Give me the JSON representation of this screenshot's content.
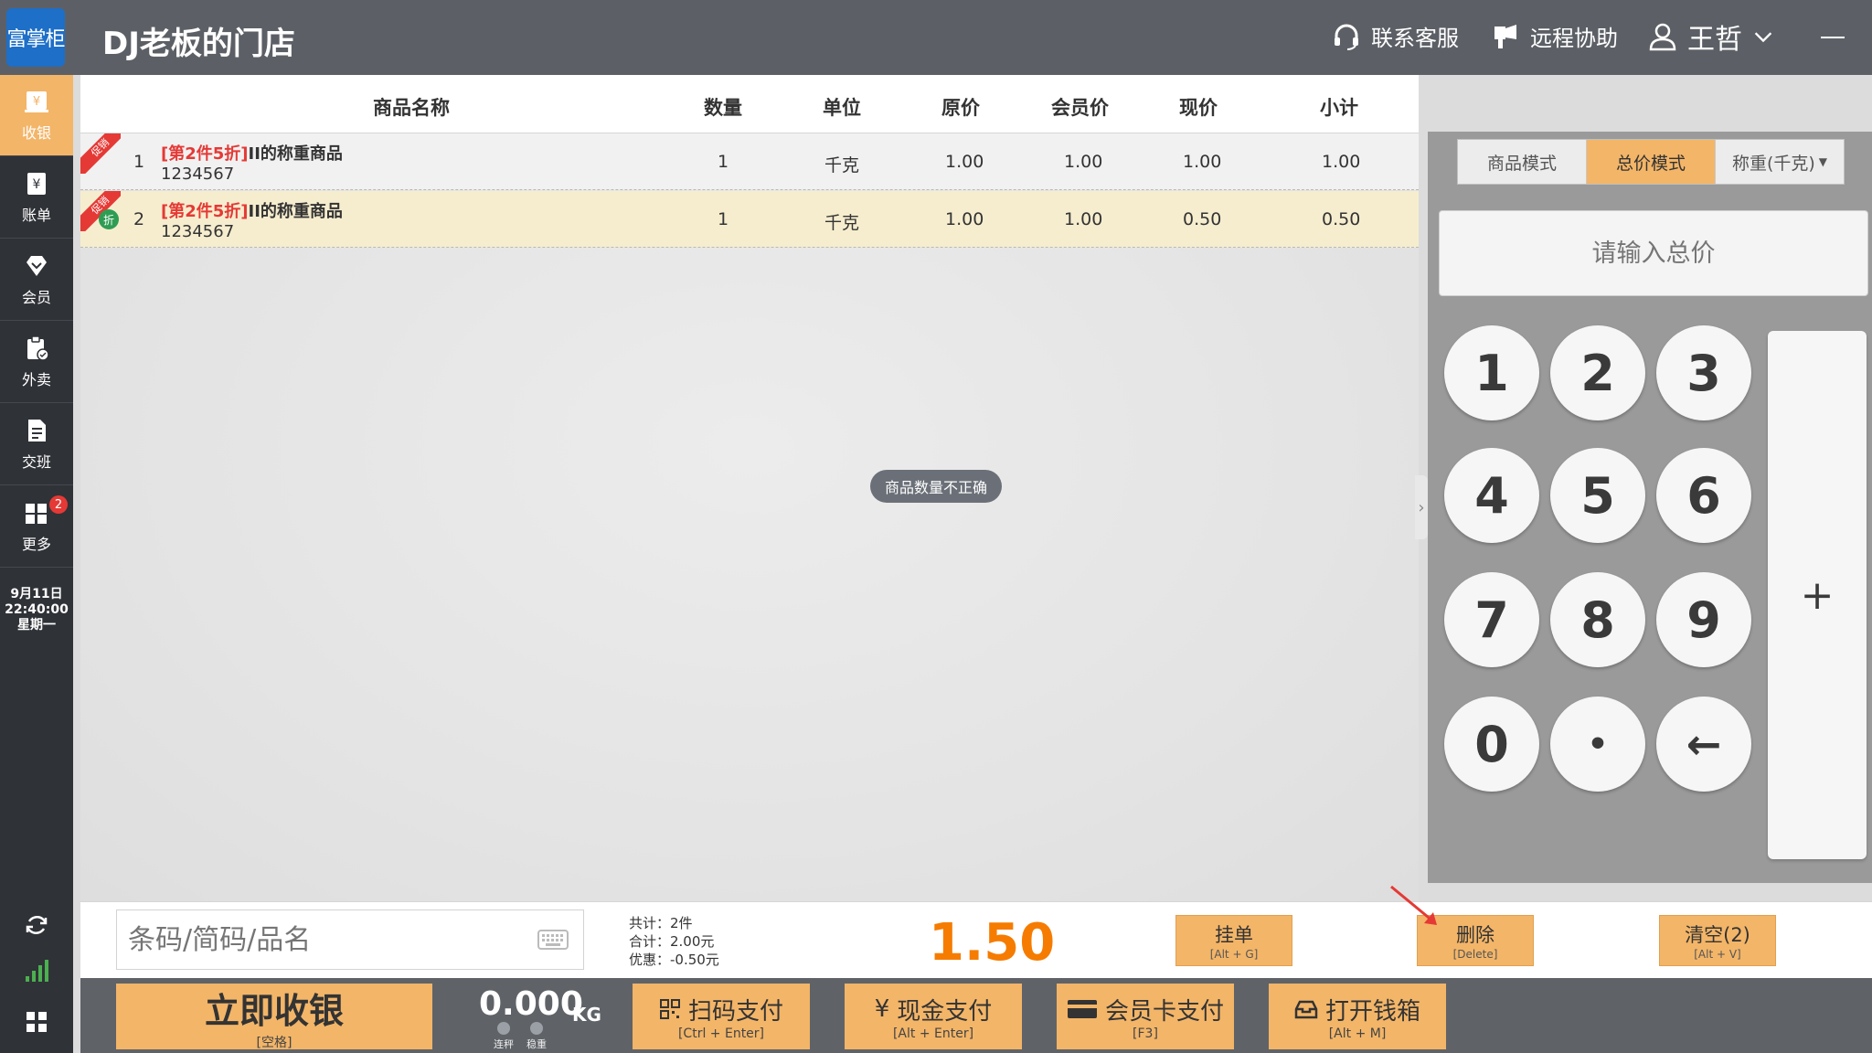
{
  "app": {
    "logo_text": "富掌柜",
    "store_name": "DJ老板的门店",
    "contact_service": "联系客服",
    "remote_assist": "远程协助",
    "user_name": "王哲"
  },
  "sidebar": {
    "items": [
      {
        "label": "收银",
        "icon": "cashier-icon"
      },
      {
        "label": "账单",
        "icon": "bill-icon"
      },
      {
        "label": "会员",
        "icon": "diamond-icon"
      },
      {
        "label": "外卖",
        "icon": "clipboard-icon"
      },
      {
        "label": "交班",
        "icon": "document-icon"
      },
      {
        "label": "更多",
        "icon": "grid-icon"
      }
    ],
    "more_badge": "2",
    "date": "9月11日",
    "time": "22:40:00",
    "weekday": "星期一"
  },
  "table": {
    "headers": [
      "商品名称",
      "数量",
      "单位",
      "原价",
      "会员价",
      "现价",
      "小计"
    ],
    "rows": [
      {
        "index": "1",
        "promo": "促销",
        "tag": "[第2件5折]",
        "name": "II的称重商品",
        "code": "1234567",
        "qty": "1",
        "unit": "千克",
        "orig": "1.00",
        "member": "1.00",
        "now": "1.00",
        "subtotal": "1.00"
      },
      {
        "index": "2",
        "promo": "促销",
        "discount_badge": "折",
        "tag": "[第2件5折]",
        "name": "II的称重商品",
        "code": "1234567",
        "qty": "1",
        "unit": "千克",
        "orig": "1.00",
        "member": "1.00",
        "now": "0.50",
        "subtotal": "0.50"
      }
    ]
  },
  "toast": "商品数量不正确",
  "keypad": {
    "modes": [
      "商品模式",
      "总价模式",
      "称重(千克)"
    ],
    "active_mode": "总价模式",
    "input_placeholder": "请输入总价",
    "keys": [
      "1",
      "2",
      "3",
      "4",
      "5",
      "6",
      "7",
      "8",
      "9",
      "0",
      "•",
      "←"
    ],
    "plus": "+"
  },
  "info": {
    "barcode_placeholder": "条码/简码/品名",
    "count": "共计：2件",
    "total": "合计：2.00元",
    "discount": "优惠：-0.50元",
    "grand_total": "1.50",
    "buttons": [
      {
        "label": "挂单",
        "shortcut": "[Alt + G]"
      },
      {
        "label": "删除",
        "shortcut": "[Delete]"
      },
      {
        "label": "清空(2)",
        "shortcut": "[Alt + V]"
      }
    ]
  },
  "actions": {
    "checkout": {
      "label": "立即收银",
      "shortcut": "[空格]"
    },
    "weight_value": "0.000",
    "weight_unit": "KG",
    "indicator_1": "连秤",
    "indicator_2": "稳重",
    "buttons": [
      {
        "label": "扫码支付",
        "shortcut": "[Ctrl + Enter]",
        "icon": "qr-icon"
      },
      {
        "label": "现金支付",
        "shortcut": "[Alt + Enter]",
        "icon": "yen-icon"
      },
      {
        "label": "会员卡支付",
        "shortcut": "[F3]",
        "icon": "card-icon"
      },
      {
        "label": "打开钱箱",
        "shortcut": "[Alt + M]",
        "icon": "drawer-icon"
      }
    ]
  },
  "colors": {
    "accent": "#f3b568",
    "total_orange": "#f57c00",
    "promo_red": "#e53935",
    "sidebar_bg": "#2f3237"
  }
}
